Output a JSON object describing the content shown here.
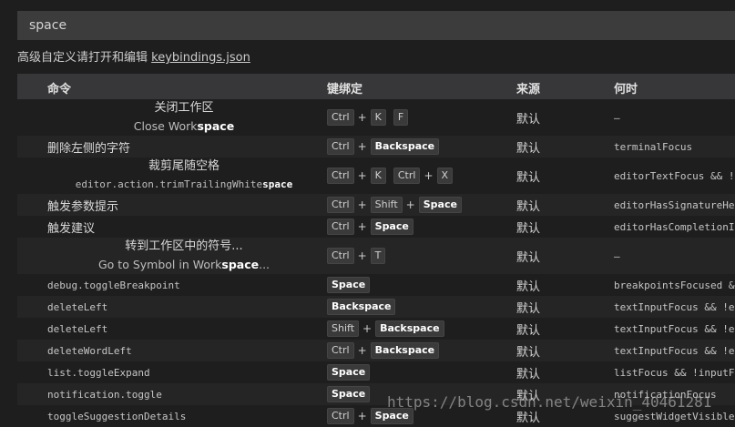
{
  "search": {
    "value": "space"
  },
  "advanced": {
    "text": "高级自定义请打开和编辑 ",
    "link": "keybindings.json"
  },
  "header": {
    "command": "命令",
    "keybinding": "键绑定",
    "source": "来源",
    "when": "何时"
  },
  "rows": [
    {
      "title": "关闭工作区",
      "sub_pre": "Close Work",
      "sub_hl": "space",
      "sub_post": "",
      "keys_html": "k",
      "source": "默认",
      "when": "—"
    },
    {
      "title": "删除左侧的字符",
      "source": "默认",
      "when": "terminalFocus"
    },
    {
      "title": "裁剪尾随空格",
      "sub_pre": "editor.action.trimTrailingWhite",
      "sub_hl": "space",
      "sub_post": "",
      "source": "默认",
      "when": "editorTextFocus && !e"
    },
    {
      "title": "触发参数提示",
      "source": "默认",
      "when": "editorHasSignatureHel"
    },
    {
      "title": "触发建议",
      "source": "默认",
      "when": "editorHasCompletionIt"
    },
    {
      "title": "转到工作区中的符号...",
      "sub_pre": "Go to Symbol in Work",
      "sub_hl": "space",
      "sub_post": "...",
      "source": "默认",
      "when": "—"
    },
    {
      "cmd": "debug.toggleBreakpoint",
      "source": "默认",
      "when": "breakpointsFocused &&"
    },
    {
      "cmd": "deleteLeft",
      "source": "默认",
      "when": "textInputFocus && !ed"
    },
    {
      "cmd": "deleteLeft",
      "source": "默认",
      "when": "textInputFocus && !ed"
    },
    {
      "cmd": "deleteWordLeft",
      "source": "默认",
      "when": "textInputFocus && !ed"
    },
    {
      "cmd": "list.toggleExpand",
      "source": "默认",
      "when": "listFocus && !inputFo"
    },
    {
      "cmd": "notification.toggle",
      "source": "默认",
      "when": "notificationFocus"
    },
    {
      "cmd": "toggleSuggestionDetails",
      "source": "默认",
      "when": "suggestWidgetVisible"
    }
  ],
  "keys": {
    "ctrl": "Ctrl",
    "shift": "Shift",
    "k": "K",
    "f": "F",
    "x": "X",
    "t": "T",
    "space": "Space",
    "backspace": "Backspace",
    "plus": "+"
  },
  "watermark": "https://blog.csdn.net/weixin_40461281"
}
